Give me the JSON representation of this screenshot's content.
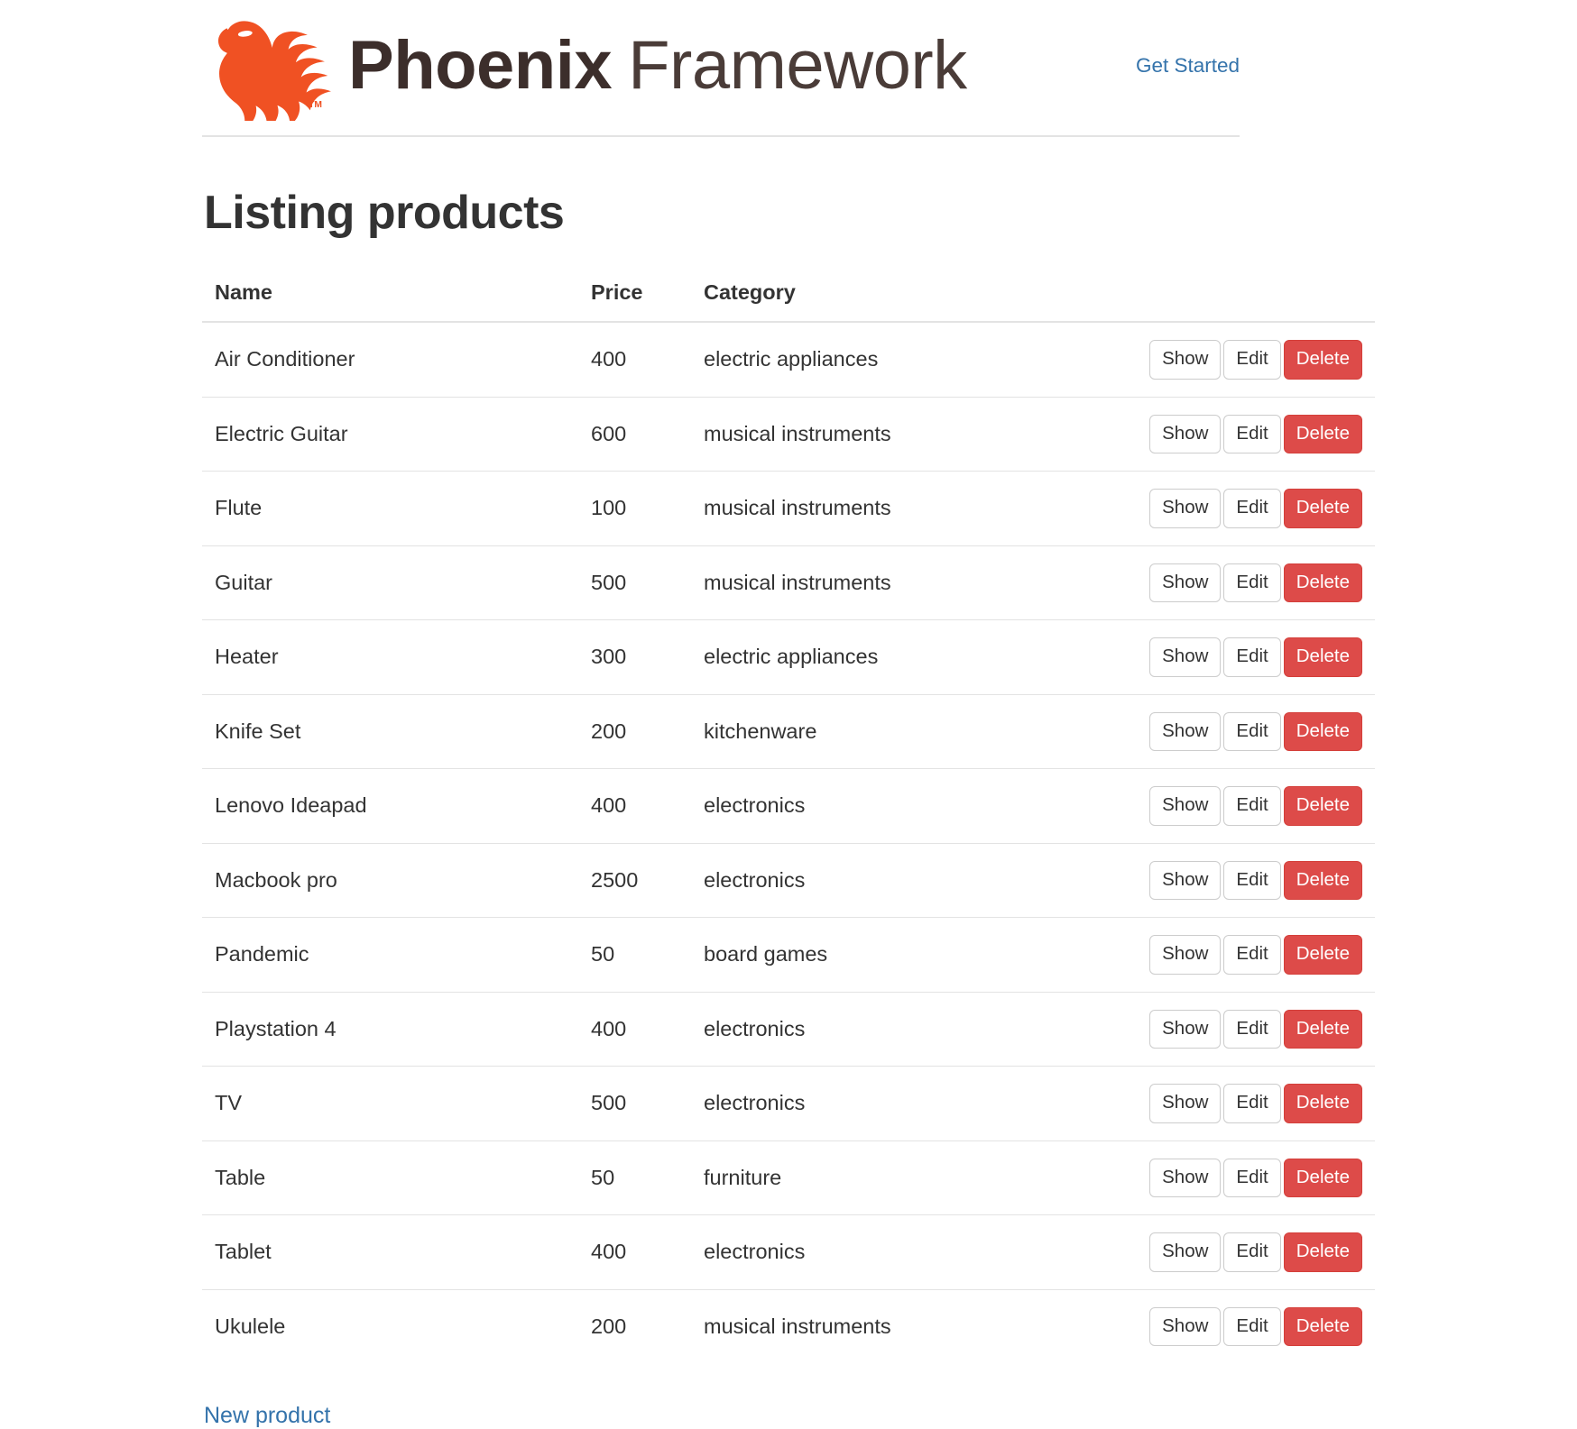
{
  "header": {
    "logo_icon": "phoenix-bird-icon",
    "brand_bold": "Phoenix",
    "brand_light": "Framework",
    "brand_color": "#f05123",
    "brand_text_color": "#3c2e2b",
    "nav_link": "Get Started",
    "link_color": "#3473ab"
  },
  "main": {
    "page_title": "Listing products",
    "table": {
      "columns": [
        "Name",
        "Price",
        "Category",
        ""
      ],
      "rows": [
        {
          "name": "Air Conditioner",
          "price": "400",
          "category": "electric appliances"
        },
        {
          "name": "Electric Guitar",
          "price": "600",
          "category": "musical instruments"
        },
        {
          "name": "Flute",
          "price": "100",
          "category": "musical instruments"
        },
        {
          "name": "Guitar",
          "price": "500",
          "category": "musical instruments"
        },
        {
          "name": "Heater",
          "price": "300",
          "category": "electric appliances"
        },
        {
          "name": "Knife Set",
          "price": "200",
          "category": "kitchenware"
        },
        {
          "name": "Lenovo Ideapad",
          "price": "400",
          "category": "electronics"
        },
        {
          "name": "Macbook pro",
          "price": "2500",
          "category": "electronics"
        },
        {
          "name": "Pandemic",
          "price": "50",
          "category": "board games"
        },
        {
          "name": "Playstation 4",
          "price": "400",
          "category": "electronics"
        },
        {
          "name": "TV",
          "price": "500",
          "category": "electronics"
        },
        {
          "name": "Table",
          "price": "50",
          "category": "furniture"
        },
        {
          "name": "Tablet",
          "price": "400",
          "category": "electronics"
        },
        {
          "name": "Ukulele",
          "price": "200",
          "category": "musical instruments"
        }
      ],
      "actions": {
        "show_label": "Show",
        "edit_label": "Edit",
        "delete_label": "Delete",
        "delete_color": "#dd4b49"
      }
    },
    "new_link": "New product"
  }
}
